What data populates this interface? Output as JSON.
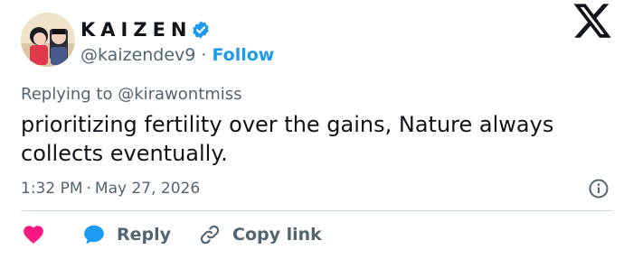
{
  "author": {
    "display_name": "KAIZEN",
    "handle": "@kaizendev9",
    "separator": "·",
    "follow_label": "Follow"
  },
  "reply": {
    "prefix": "Replying to",
    "mention": "@kirawontmiss"
  },
  "tweet": {
    "text": "prioritizing fertility over the gains, Nature always collects eventually.",
    "time": "1:32 PM",
    "separator": "·",
    "date": "May 27, 2026"
  },
  "actions": {
    "like_icon": "heart-icon",
    "reply_label": "Reply",
    "copy_link_label": "Copy link"
  },
  "colors": {
    "accent": "#1d9bf0",
    "like": "#f91880",
    "muted": "#536471",
    "text": "#0f1419",
    "divider": "#cfd9de"
  }
}
